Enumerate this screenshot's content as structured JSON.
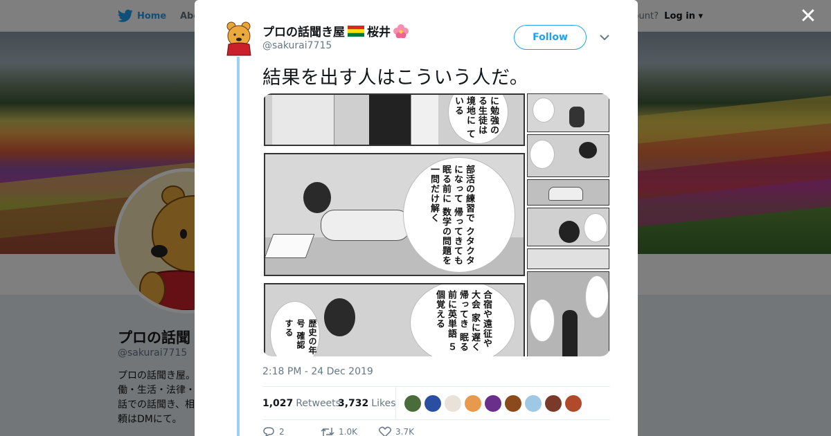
{
  "nav": {
    "home_label": "Home",
    "about_label": "Abo",
    "account_prompt": "account?",
    "login_label": "Log in"
  },
  "profile": {
    "name": "プロの話聞",
    "handle": "@sakurai7715",
    "bio_lines": [
      "プロの話聞き屋。",
      "働・生活・法律・",
      "話での話聞き、相",
      "頼はDMにて。"
    ]
  },
  "tweet": {
    "author_name": "プロの話聞き屋",
    "author_name_suffix": "桜井",
    "author_handle": "@sakurai7715",
    "follow_label": "Follow",
    "text": "結果を出す人はこういう人だ。",
    "timestamp": "2:18 PM - 24 Dec 2019",
    "retweets_count": "1,027",
    "retweets_label": "Retweets",
    "likes_count": "3,732",
    "likes_label": "Likes",
    "reply_count": "2",
    "retweet_action_count": "1.0K",
    "like_action_count": "3.7K"
  },
  "manga": {
    "panel1_text": "に勉強の る生徒は 境地に ている",
    "panel2_text": "部活の練習で クタクタになって 帰ってきても 眠る前に 数学の問題を 一問だけ解く",
    "panel3_text": "合宿や遠征や大会 家に遅く帰ってき 眠る前に英単語 ５個覚える",
    "panel3_small": "歴史の年号 確認する"
  },
  "colors": {
    "accent": "#1da1f2",
    "thread_line": "#9ad1f5",
    "text": "#14171a",
    "muted": "#657786"
  },
  "icons": {
    "close": "close-icon",
    "bird": "twitter-bird-icon",
    "flag": "flag-icon",
    "flower": "hibiscus-icon",
    "caret": "chevron-down-icon",
    "reply": "reply-icon",
    "retweet": "retweet-icon",
    "like": "heart-icon"
  },
  "likers": [
    "#4a6b3a",
    "#2b4fa0",
    "#e8e2d8",
    "#e89a4c",
    "#6a2f8a",
    "#8a4a1c",
    "#9fc7e6",
    "#7a3a2a",
    "#b04a2a"
  ]
}
